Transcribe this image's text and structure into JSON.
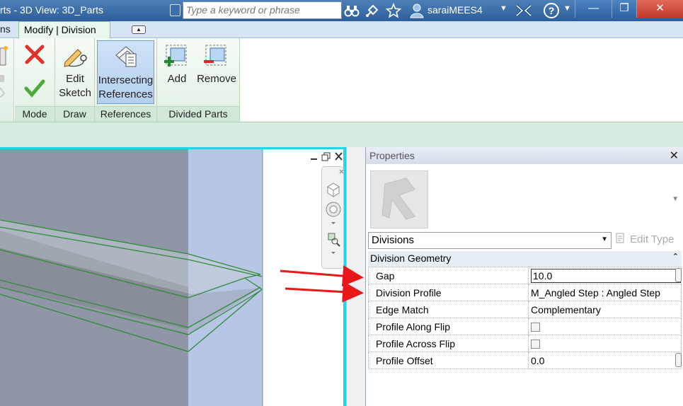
{
  "title_bar": {
    "app_title": "rts - 3D View: 3D_Parts",
    "search_placeholder": "Type a keyword or phrase",
    "user_name": "saraiMEES4",
    "help_symbol": "?",
    "min_symbol": "—",
    "restore_symbol": "❐",
    "close_symbol": "✕"
  },
  "ribbon": {
    "previous_tab_fragment": "ns",
    "active_tab": "Modify | Division",
    "panels": [
      {
        "label": "Mode",
        "buttons": []
      },
      {
        "label": "Draw",
        "buttons": [
          {
            "line1": "Edit",
            "line2": "Sketch"
          }
        ]
      },
      {
        "label": "References",
        "buttons": [
          {
            "line1": "Intersecting",
            "line2": "References"
          }
        ]
      },
      {
        "label": "Divided Parts",
        "buttons": [
          {
            "line1": "Add"
          },
          {
            "line1": "Remove"
          }
        ]
      }
    ]
  },
  "properties": {
    "title": "Properties",
    "type_selector_value": "Divisions",
    "edit_type_label": "Edit Type",
    "group_label": "Division Geometry",
    "rows": [
      {
        "label": "Gap",
        "value": "10.0"
      },
      {
        "label": "Division Profile",
        "value": "M_Angled Step : Angled Step"
      },
      {
        "label": "Edge Match",
        "value": "Complementary"
      },
      {
        "label": "Profile Along Flip",
        "value": ""
      },
      {
        "label": "Profile Across Flip",
        "value": ""
      },
      {
        "label": "Profile Offset",
        "value": "0.0"
      }
    ]
  },
  "colors": {
    "title_bar": "#2d5e9a",
    "active_tab_bg": "#e9f7ec",
    "view_border": "#22d6e6",
    "annotation_arrow": "#e8171a"
  },
  "icons": [
    "binoculars-icon",
    "satellite-icon",
    "star-icon",
    "user-icon",
    "exchange-icon",
    "help-icon",
    "cancel-icon",
    "finish-icon",
    "edit-sketch-icon",
    "intersecting-references-icon",
    "add-parts-icon",
    "remove-parts-icon",
    "view-cube-icon",
    "steering-wheel-icon",
    "zoom-icon"
  ]
}
